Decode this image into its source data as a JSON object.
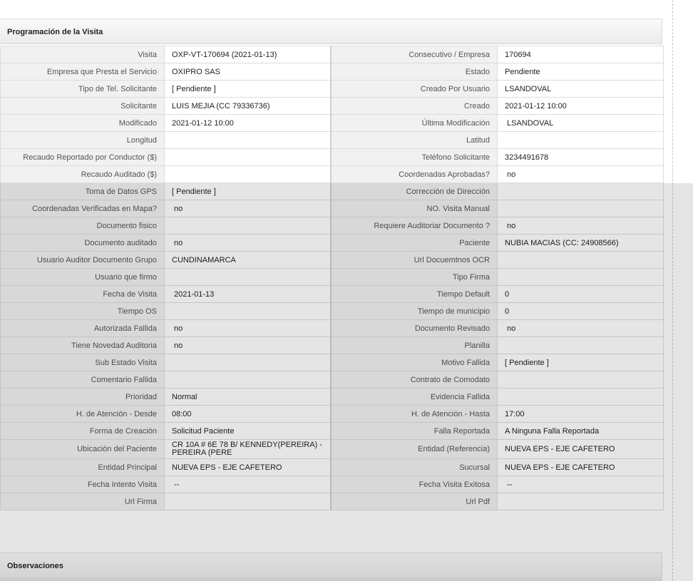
{
  "panel": {
    "title": "Programación de la Visita",
    "observaciones_title": "Observaciones"
  },
  "rows": [
    {
      "l1": "Visita",
      "v1": "OXP-VT-170694 (2021-01-13)",
      "l2": "Consecutivo / Empresa",
      "v2": "170694"
    },
    {
      "l1": "Empresa que Presta el Servicio",
      "v1": "OXIPRO SAS",
      "l2": "Estado",
      "v2": "Pendiente"
    },
    {
      "l1": "Tipo de Tel. Solicitante",
      "v1": "[ Pendiente ]",
      "l2": "Creado Por Usuario",
      "v2": "LSANDOVAL"
    },
    {
      "l1": "Solicitante",
      "v1": "LUIS MEJIA (CC 79336736)",
      "l2": "Creado",
      "v2": "2021-01-12 10:00"
    },
    {
      "l1": "Modificado",
      "v1": "2021-01-12 10:00",
      "l2": "Última Modificación",
      "v2": "LSANDOVAL"
    },
    {
      "l1": "Longitud",
      "v1": "",
      "l2": "Latitud",
      "v2": ""
    },
    {
      "l1": "Recaudo Reportado por Conductor ($)",
      "v1": "",
      "l2": "Teléfono Solicitante",
      "v2": "3234491678"
    },
    {
      "l1": "Recaudo Auditado ($)",
      "v1": "",
      "l2": "Coordenadas Aprobadas?",
      "v2": "no"
    },
    {
      "l1": "Toma de Datos GPS",
      "v1": "[ Pendiente ]",
      "l2": "Corrección de Dirección",
      "v2": ""
    },
    {
      "l1": "Coordenadas Verificadas en Mapa?",
      "v1": "no",
      "l2": "NO. Visita Manual",
      "v2": ""
    },
    {
      "l1": "Documento fisico",
      "v1": "",
      "l2": "Requiere Auditoriar Documento ?",
      "v2": "no"
    },
    {
      "l1": "Documento auditado",
      "v1": "no",
      "l2": "Paciente",
      "v2": "NUBIA MACIAS (CC: 24908566)"
    },
    {
      "l1": "Usuario Auditor Documento Grupo",
      "v1": "CUNDINAMARCA",
      "l2": "Url Docuemtnos OCR",
      "v2": ""
    },
    {
      "l1": "Usuario que firmo",
      "v1": "",
      "l2": "Tipo Firma",
      "v2": ""
    },
    {
      "l1": "Fecha de Visita",
      "v1": "2021-01-13",
      "l2": "Tiempo Default",
      "v2": "0"
    },
    {
      "l1": "Tiempo OS",
      "v1": "",
      "l2": "Tiempo de municipio",
      "v2": "0"
    },
    {
      "l1": "Autorizada Fallida",
      "v1": "no",
      "l2": "Documento Revisado",
      "v2": "no"
    },
    {
      "l1": "Tiene Novedad Auditoria",
      "v1": "no",
      "l2": "Planilla",
      "v2": ""
    },
    {
      "l1": "Sub Estado Visita",
      "v1": "",
      "l2": "Motivo Fallida",
      "v2": "[ Pendiente ]"
    },
    {
      "l1": "Comentario Fallida",
      "v1": "",
      "l2": "Contrato de Comodato",
      "v2": ""
    },
    {
      "l1": "Prioridad",
      "v1": "Normal",
      "l2": "Evidencia Fallida",
      "v2": ""
    },
    {
      "l1": "H. de Atención - Desde",
      "v1": "08:00",
      "l2": "H. de Atención - Hasta",
      "v2": "17:00"
    },
    {
      "l1": "Forma de Creación",
      "v1": "Solicitud Paciente",
      "l2": "Falla Reportada",
      "v2": "A Ninguna Falla Reportada"
    },
    {
      "l1": "Ubicación del Paciente",
      "v1": "CR 10A # 6E 78 B/ KENNEDY(PEREIRA) - PEREIRA (PERE",
      "l2": "Entidad (Referencia)",
      "v2": "NUEVA EPS - EJE CAFETERO"
    },
    {
      "l1": "Entidad Principal",
      "v1": "NUEVA EPS - EJE CAFETERO",
      "l2": "Sucursal",
      "v2": "NUEVA EPS - EJE CAFETERO"
    },
    {
      "l1": "Fecha Intento Visita",
      "v1": "--",
      "l2": "Fecha Visita Exitosa",
      "v2": "--"
    },
    {
      "l1": "Url Firma",
      "v1": "",
      "l2": "Url Pdf",
      "v2": ""
    }
  ]
}
